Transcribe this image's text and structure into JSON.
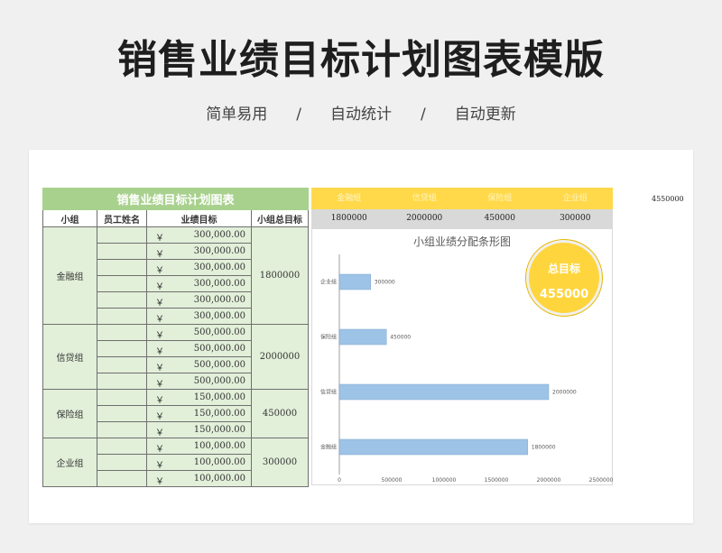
{
  "page": {
    "title": "销售业绩目标计划图表模版",
    "features": [
      "简单易用",
      "自动统计",
      "自动更新"
    ],
    "separator": "/"
  },
  "table": {
    "title": "销售业绩目标计划图表",
    "headers": [
      "小组",
      "员工姓名",
      "业绩目标",
      "小组总目标"
    ],
    "currency": "￥",
    "groups": [
      {
        "name": "金融组",
        "total": "1800000",
        "amounts": [
          "300,000.00",
          "300,000.00",
          "300,000.00",
          "300,000.00",
          "300,000.00",
          "300,000.00"
        ]
      },
      {
        "name": "信贷组",
        "total": "2000000",
        "amounts": [
          "500,000.00",
          "500,000.00",
          "500,000.00",
          "500,000.00"
        ]
      },
      {
        "name": "保险组",
        "total": "450000",
        "amounts": [
          "150,000.00",
          "150,000.00",
          "150,000.00"
        ]
      },
      {
        "name": "企业组",
        "total": "300000",
        "amounts": [
          "100,000.00",
          "100,000.00",
          "100,000.00"
        ]
      }
    ]
  },
  "summary": {
    "groups": [
      "金融组",
      "信贷组",
      "保险组",
      "企业组"
    ],
    "values": [
      "1800000",
      "2000000",
      "450000",
      "300000"
    ],
    "grand_total": "4550000"
  },
  "badge": {
    "label": "总目标",
    "value": "455000"
  },
  "colors": {
    "green_header": "#a9d18e",
    "green_cell": "#e2efd9",
    "yellow": "#ffd94a",
    "bar": "#9dc3e6"
  },
  "chart_data": {
    "type": "bar",
    "orientation": "horizontal",
    "title": "小组业绩分配条形图",
    "categories": [
      "企业组",
      "保险组",
      "信贷组",
      "金融组"
    ],
    "values": [
      300000,
      450000,
      2000000,
      1800000
    ],
    "data_labels": [
      "300000",
      "450000",
      "2000000",
      "1800000"
    ],
    "xlim": [
      0,
      2500000
    ],
    "x_ticks": [
      "0",
      "500000",
      "1000000",
      "1500000",
      "2000000",
      "2500000"
    ],
    "grid": false
  }
}
